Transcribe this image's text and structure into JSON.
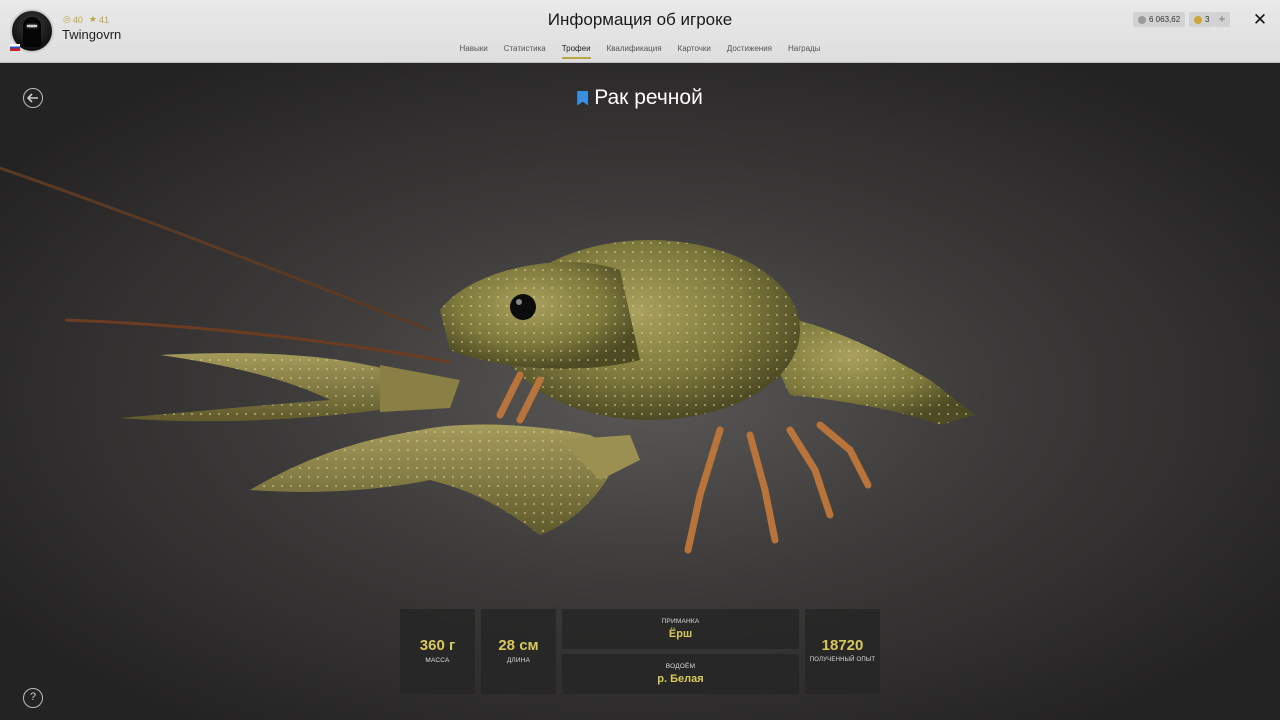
{
  "header": {
    "title": "Информация об игроке",
    "player": {
      "name": "Twingovrn",
      "stat_a": "40",
      "stat_b": "41"
    },
    "tabs": [
      {
        "label": "Навыки"
      },
      {
        "label": "Статистика"
      },
      {
        "label": "Трофеи"
      },
      {
        "label": "Квалификация"
      },
      {
        "label": "Карточки"
      },
      {
        "label": "Достижения"
      },
      {
        "label": "Награды"
      }
    ],
    "active_tab": "Трофеи",
    "silver": "6 063,62",
    "gold": "3",
    "plus_label": "+",
    "close_label": "✕"
  },
  "trophy": {
    "name": "Рак речной",
    "mass_value": "360 г",
    "mass_label": "масса",
    "length_value": "28 см",
    "length_label": "длина",
    "bait_label": "приманка",
    "bait_value": "Ёрш",
    "water_label": "водоём",
    "water_value": "р. Белая",
    "xp_value": "18720",
    "xp_label": "полученный опыт"
  },
  "controls": {
    "back_icon": "back-arrow-icon",
    "help_label": "?"
  },
  "colors": {
    "accent": "#d9c95a",
    "bookmark": "#3a8fe0",
    "header_bg": "#e4e4e4"
  }
}
